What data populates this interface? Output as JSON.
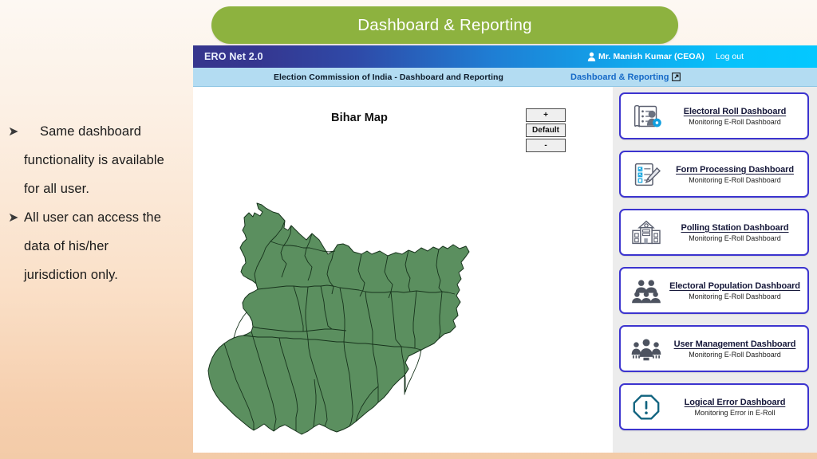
{
  "slide": {
    "banner_title": "Dashboard & Reporting",
    "banner_color": "#8db23f",
    "background_top_color": "#fdf8f3",
    "background_bottom_color": "#f3cba8"
  },
  "notes": {
    "bullets": [
      {
        "marker": "➤",
        "lines": [
          "Same dashboard",
          "functionality is available",
          "for all user."
        ]
      },
      {
        "marker": "➤",
        "lines": [
          "All user can access the",
          "data of his/her",
          "jurisdiction only."
        ]
      }
    ]
  },
  "app": {
    "topbar": {
      "brand": "ERO Net 2.0",
      "user_icon": "user-icon",
      "user_name": "Mr. Manish Kumar (CEOA)",
      "logout_label": "Log out",
      "gradient_start": "#36368e",
      "gradient_end": "#04c8ff"
    },
    "subbar": {
      "title": "Election Commission of India - Dashboard and Reporting",
      "link_label": "Dashboard & Reporting",
      "link_icon": "external-link-icon",
      "link_color": "#1569c7",
      "background_color": "#b3dcf2"
    },
    "map_pane": {
      "heading": "Bihar Map",
      "zoom_controls": [
        {
          "label": "+",
          "name": "zoom-in-button"
        },
        {
          "label": "Default",
          "name": "zoom-default-button"
        },
        {
          "label": "-",
          "name": "zoom-out-button"
        }
      ],
      "map": {
        "region": "Bihar",
        "fill_color": "#5b8f5f",
        "stroke_color": "#17331c"
      }
    },
    "dashboard_cards": [
      {
        "title": "Electoral Roll Dashboard",
        "subtitle": "Monitoring E-Roll Dashboard",
        "icon": "electoral-roll-icon"
      },
      {
        "title": "Form Processing Dashboard",
        "subtitle": "Monitoring E-Roll Dashboard",
        "icon": "form-processing-icon"
      },
      {
        "title": "Polling Station Dashboard",
        "subtitle": "Monitoring E-Roll Dashboard",
        "icon": "polling-station-icon"
      },
      {
        "title": "Electoral Population Dashboard",
        "subtitle": "Monitoring E-Roll Dashboard",
        "icon": "electoral-population-icon"
      },
      {
        "title": "User Management Dashboard",
        "subtitle": "Monitoring E-Roll Dashboard",
        "icon": "user-management-icon"
      },
      {
        "title": "Logical Error Dashboard",
        "subtitle": "Monitoring Error in E-Roll",
        "icon": "logical-error-icon"
      }
    ],
    "card_border_color": "#3c34cf",
    "cards_panel_background": "#ececec"
  }
}
